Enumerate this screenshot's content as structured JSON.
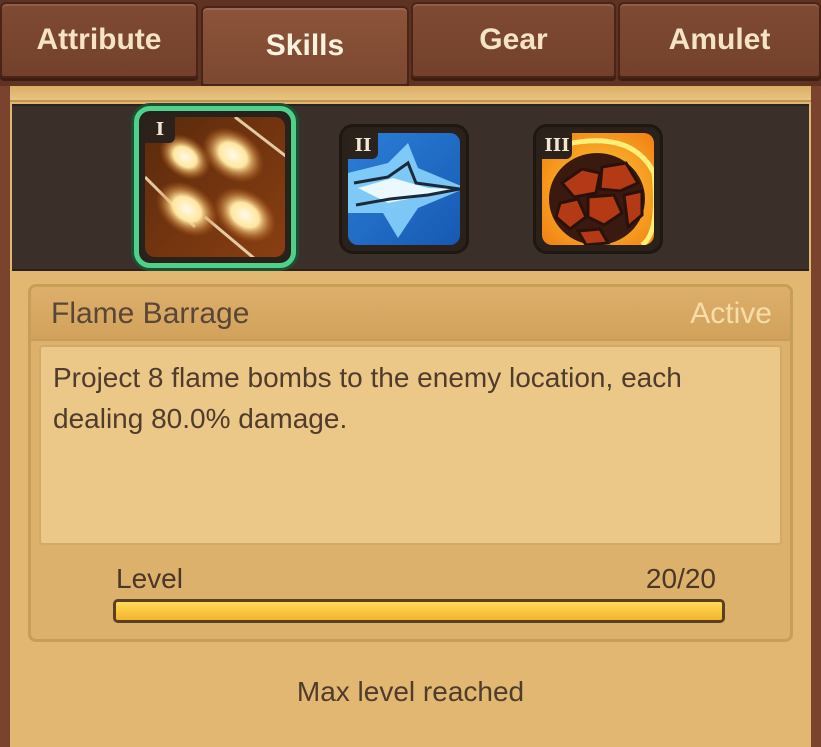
{
  "tabs": [
    {
      "label": "Attribute",
      "active": false
    },
    {
      "label": "Skills",
      "active": true
    },
    {
      "label": "Gear",
      "active": false
    },
    {
      "label": "Amulet",
      "active": false
    }
  ],
  "skills": [
    {
      "numeral": "I",
      "icon": "flame-barrage-icon",
      "selected": true
    },
    {
      "numeral": "II",
      "icon": "ice-spear-icon",
      "selected": false
    },
    {
      "numeral": "III",
      "icon": "lava-shield-icon",
      "selected": false
    }
  ],
  "selected_skill": {
    "name": "Flame Barrage",
    "type": "Active",
    "description": "Project 8 flame bombs to the enemy location, each dealing 80.0% damage.",
    "level_label": "Level",
    "level_value": "20/20",
    "level_progress": 1.0,
    "status": "Max level reached"
  },
  "colors": {
    "selected_border": "#4fd08b",
    "level_fill": "#ffd95a",
    "active_text": "#f5dea7"
  }
}
